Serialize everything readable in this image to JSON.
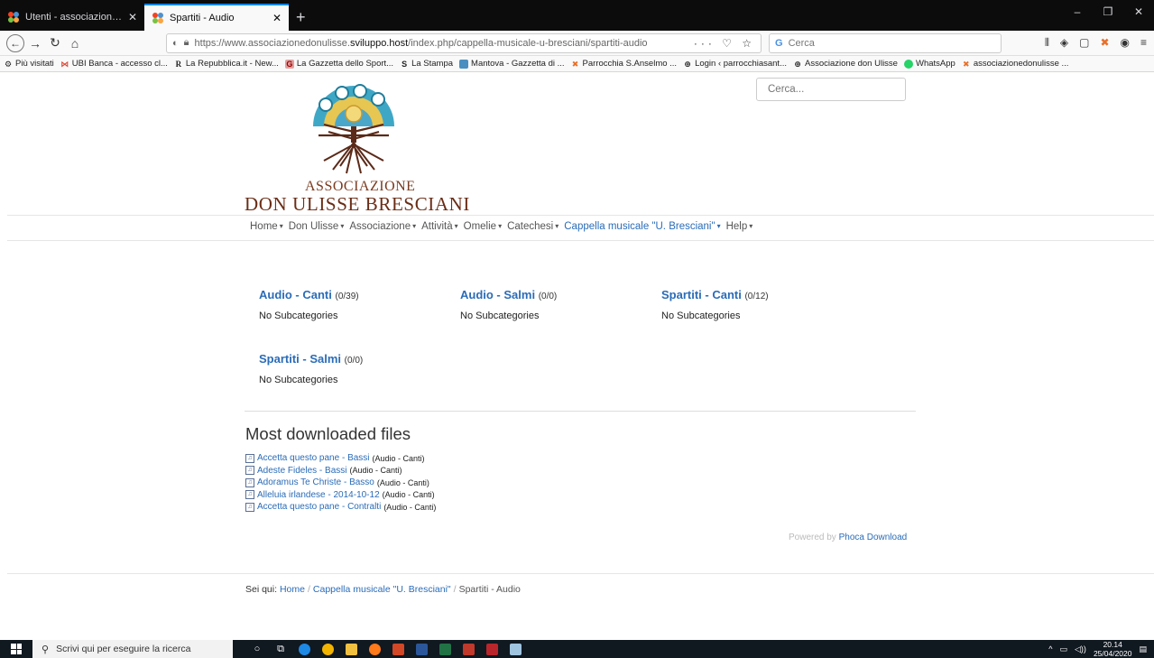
{
  "browser": {
    "tabs": [
      {
        "title": "Utenti - associazionedonulisse",
        "active": false
      },
      {
        "title": "Spartiti - Audio",
        "active": true
      }
    ],
    "url_prefix": "https://www.associazionedonulisse.",
    "url_host": "sviluppo.host",
    "url_path": "/index.php/cappella-musicale-u-bresciani/spartiti-audio",
    "search_placeholder": "Cerca",
    "bookmarks": [
      "Più visitati",
      "UBI Banca - accesso cl...",
      "La Repubblica.it - New...",
      "La Gazzetta dello Sport...",
      "La Stampa",
      "Mantova - Gazzetta di ...",
      "Parrocchia S.Anselmo ...",
      "Login ‹ parrocchiasant...",
      "Associazione don Ulisse",
      "WhatsApp",
      "associazionedonulisse ..."
    ]
  },
  "site": {
    "logo_line1": "ASSOCIAZIONE",
    "logo_line2": "DON ULISSE BRESCIANI",
    "search_placeholder": "Cerca...",
    "menu": [
      {
        "label": "Home",
        "active": false
      },
      {
        "label": "Don Ulisse",
        "active": false
      },
      {
        "label": "Associazione",
        "active": false
      },
      {
        "label": "Attività",
        "active": false
      },
      {
        "label": "Omelie",
        "active": false
      },
      {
        "label": "Catechesi",
        "active": false
      },
      {
        "label": "Cappella musicale \"U. Bresciani\"",
        "active": true
      },
      {
        "label": "Help",
        "active": false
      }
    ],
    "categories": [
      {
        "title": "Audio - Canti",
        "count": "(0/39)",
        "sub": "No Subcategories"
      },
      {
        "title": "Audio - Salmi",
        "count": "(0/0)",
        "sub": "No Subcategories"
      },
      {
        "title": "Spartiti - Canti",
        "count": "(0/12)",
        "sub": "No Subcategories"
      },
      {
        "title": "Spartiti - Salmi",
        "count": "(0/0)",
        "sub": "No Subcategories"
      }
    ],
    "most_downloaded_title": "Most downloaded files",
    "downloads": [
      {
        "name": "Accetta questo pane - Bassi",
        "cat": "(Audio - Canti)"
      },
      {
        "name": "Adeste Fideles - Bassi",
        "cat": "(Audio - Canti)"
      },
      {
        "name": "Adoramus Te Christe - Basso",
        "cat": "(Audio - Canti)"
      },
      {
        "name": "Alleluia irlandese - 2014-10-12",
        "cat": "(Audio - Canti)"
      },
      {
        "name": "Accetta questo pane - Contralti",
        "cat": "(Audio - Canti)"
      }
    ],
    "powered_by": "Powered by",
    "powered_link": "Phoca Download",
    "breadcrumb": {
      "label": "Sei qui:",
      "home": "Home",
      "parent": "Cappella musicale \"U. Bresciani\"",
      "current": "Spartiti - Audio"
    }
  },
  "taskbar": {
    "search_placeholder": "Scrivi qui per eseguire la ricerca",
    "time": "20.14",
    "date": "25/04/2020"
  }
}
